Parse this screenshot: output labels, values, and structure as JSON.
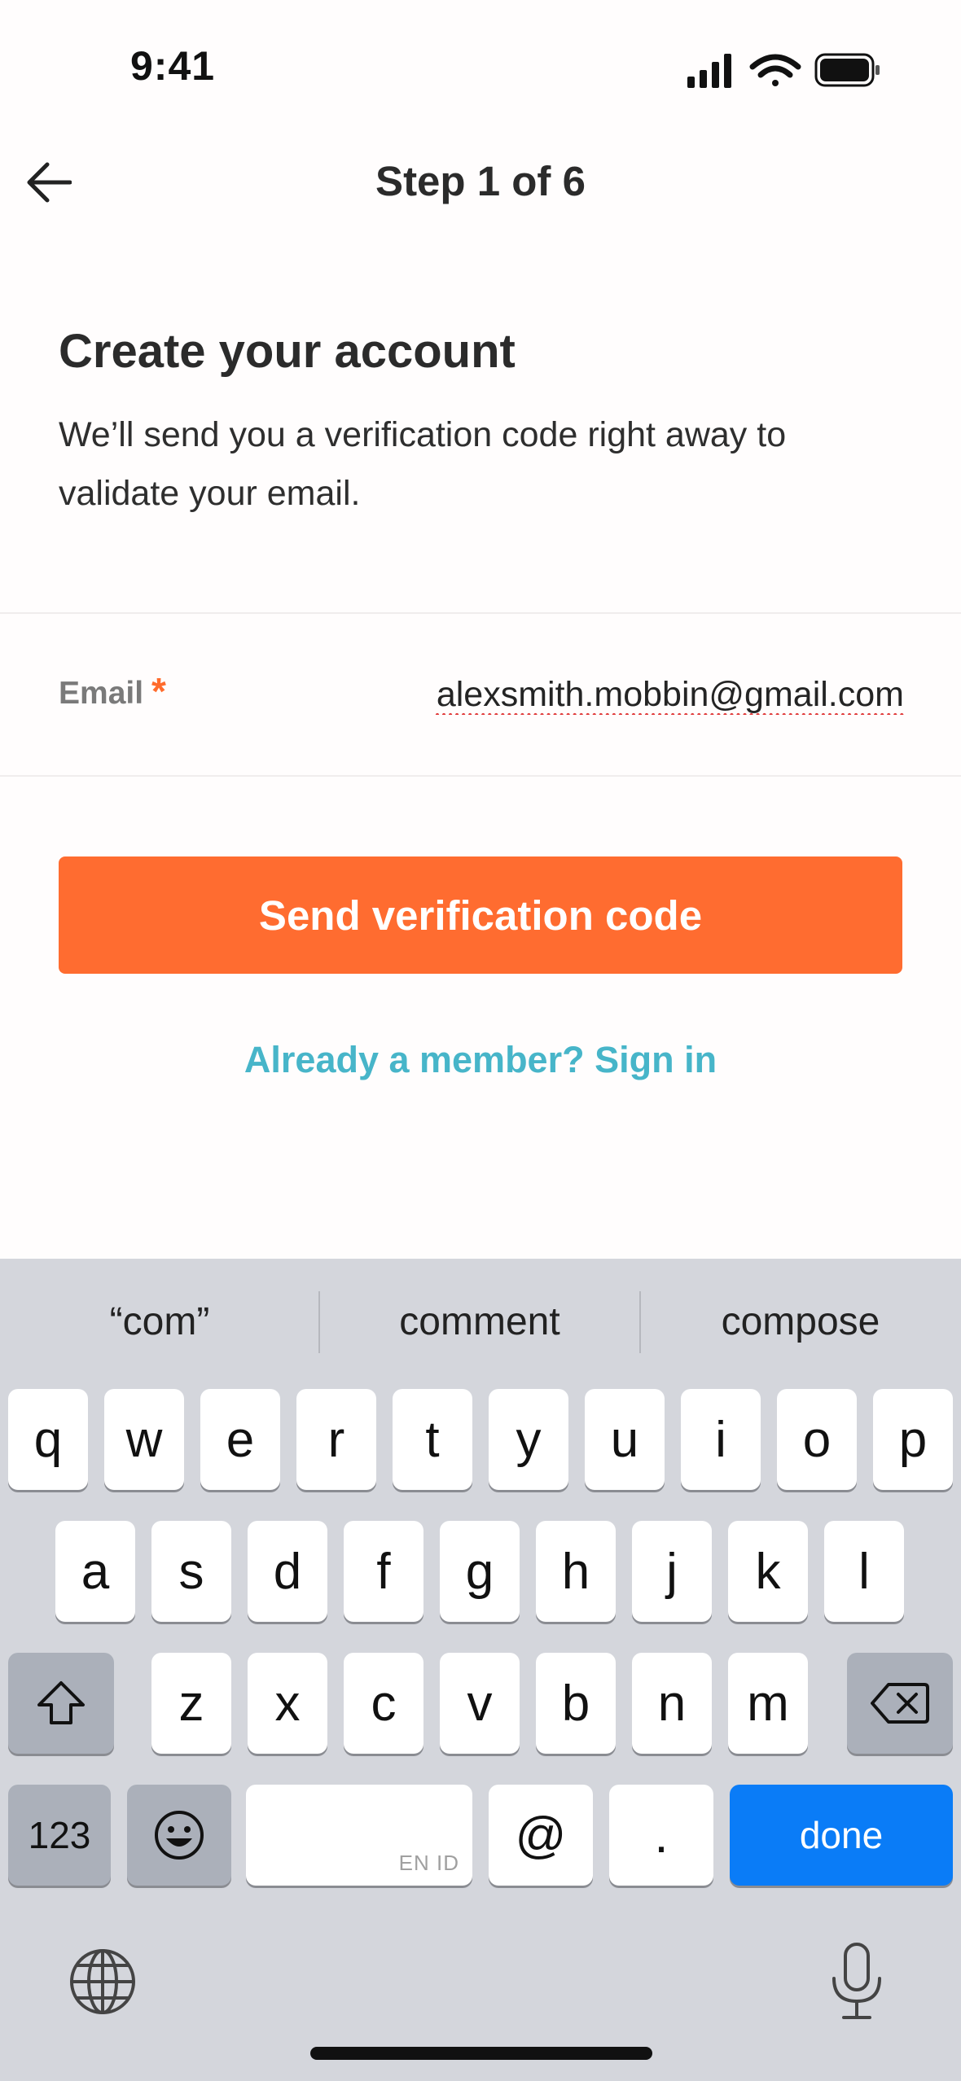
{
  "status": {
    "time": "9:41"
  },
  "nav": {
    "title": "Step 1 of 6"
  },
  "header": {
    "heading": "Create your account",
    "subtitle": "We’ll send you a verification code right away to validate your email."
  },
  "form": {
    "email_label": "Email",
    "required_mark": "*",
    "email_value": "alexsmith.mobbin@gmail.com"
  },
  "actions": {
    "send_label": "Send verification code",
    "signin_label": "Already a member? Sign in"
  },
  "keyboard": {
    "suggestions": [
      "“com”",
      "comment",
      "compose"
    ],
    "row1": [
      "q",
      "w",
      "e",
      "r",
      "t",
      "y",
      "u",
      "i",
      "o",
      "p"
    ],
    "row2": [
      "a",
      "s",
      "d",
      "f",
      "g",
      "h",
      "j",
      "k",
      "l"
    ],
    "row3": [
      "z",
      "x",
      "c",
      "v",
      "b",
      "n",
      "m"
    ],
    "numbers_label": "123",
    "space_hint": "EN ID",
    "at_label": "@",
    "dot_label": ".",
    "done_label": "done"
  },
  "colors": {
    "accent": "#ff6c30",
    "link": "#47b5c9",
    "done": "#0a7cf7",
    "required": "#ff6b2c"
  }
}
